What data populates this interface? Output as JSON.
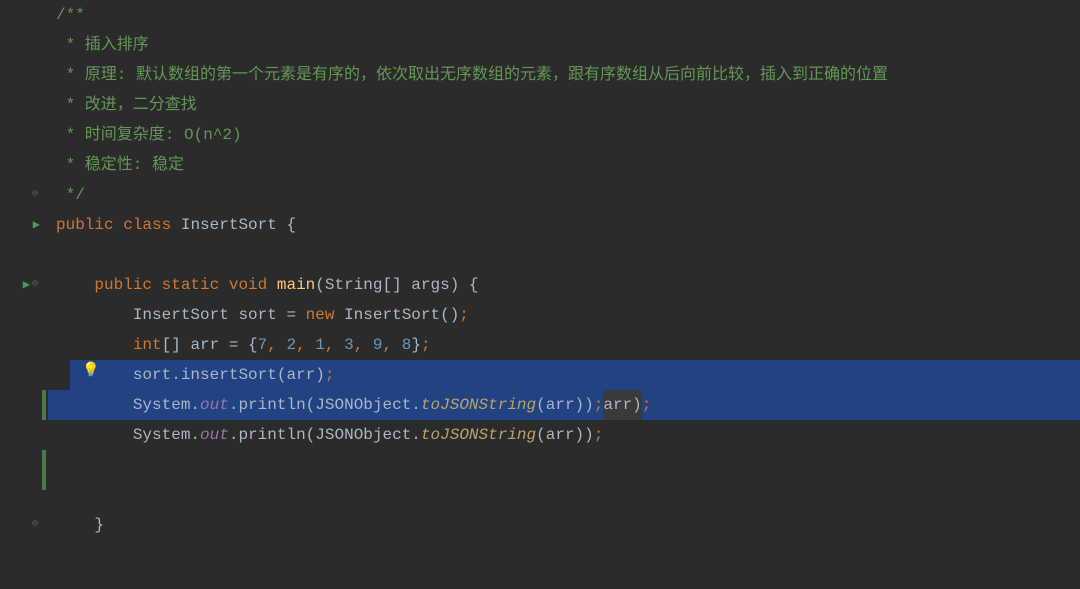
{
  "comment": {
    "l1": "/**",
    "l2": " * 插入排序",
    "l3": " * 原理: 默认数组的第一个元素是有序的，依次取出无序数组的元素，跟有序数组从后向前比较，插入到正确的位置",
    "l4": " * 改进，二分查找",
    "l5": " * 时间复杂度: O(n^2)",
    "l6": " * 稳定性: 稳定",
    "l7": " */"
  },
  "kw": {
    "public": "public",
    "class": "class",
    "static": "static",
    "void": "void",
    "new": "new",
    "int_arr": "int"
  },
  "names": {
    "InsertSort": "InsertSort",
    "main": "main",
    "String": "String",
    "args": "args",
    "sort": "sort",
    "arr": "arr",
    "insertSort": "insertSort",
    "System": "System",
    "out": "out",
    "println": "println",
    "JSONObject": "JSONObject",
    "toJSONString": "toJSONString"
  },
  "arr_values": [
    "7",
    "2",
    "1",
    "3",
    "9",
    "8"
  ],
  "icons": {
    "run": "▶",
    "fold_open": "⊖",
    "fold_close": "⊖",
    "bulb": "💡"
  }
}
